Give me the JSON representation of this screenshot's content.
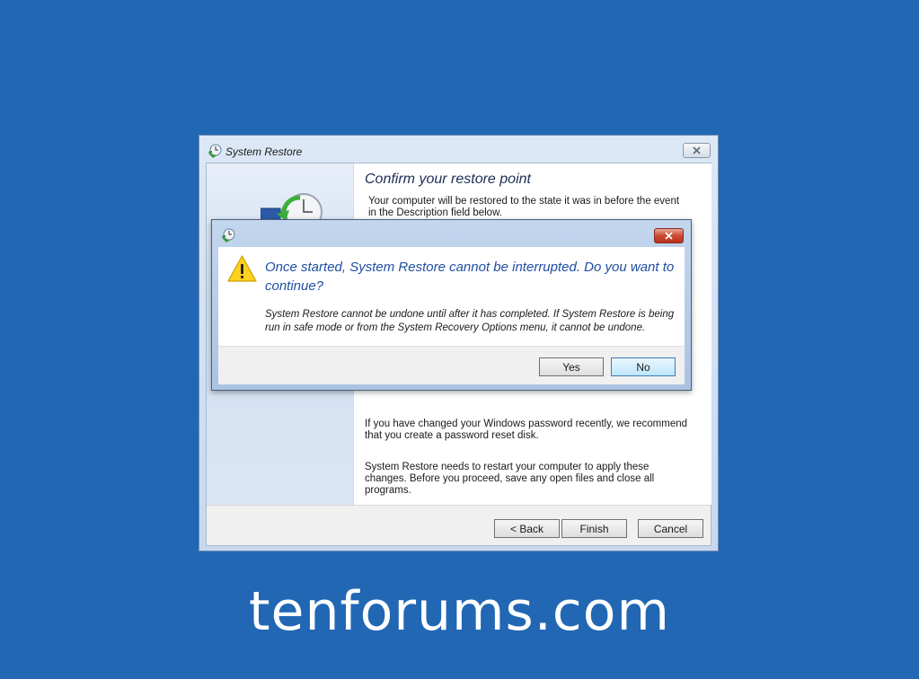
{
  "window": {
    "title": "System Restore",
    "heading": "Confirm your restore point",
    "description": "Your computer will be restored to the state it was in before the event in the Description field below.",
    "paragraph_password": "If you have changed your Windows password recently, we recommend that you create a password reset disk.",
    "paragraph_restart": "System Restore needs to restart your computer to apply these changes. Before you proceed, save any open files and close all programs.",
    "buttons": {
      "back": "< Back",
      "finish": "Finish",
      "cancel": "Cancel"
    },
    "icons": {
      "title": "system-restore-icon",
      "close": "close-icon",
      "banner": "restore-clock-icon"
    }
  },
  "dialog": {
    "main_instruction": "Once started, System Restore cannot be interrupted. Do you want to continue?",
    "content": "System Restore cannot be undone until after it has completed. If System Restore is being run in safe mode or from the System Recovery Options menu, it cannot be undone.",
    "buttons": {
      "yes": "Yes",
      "no": "No"
    },
    "icons": {
      "title": "system-restore-icon",
      "close": "close-icon",
      "warning": "warning-icon"
    }
  },
  "watermark": "tenforums.com",
  "colors": {
    "desktop": "#2167b4",
    "main_instruction": "#1f4ea3",
    "close_red": "#c94a32"
  }
}
